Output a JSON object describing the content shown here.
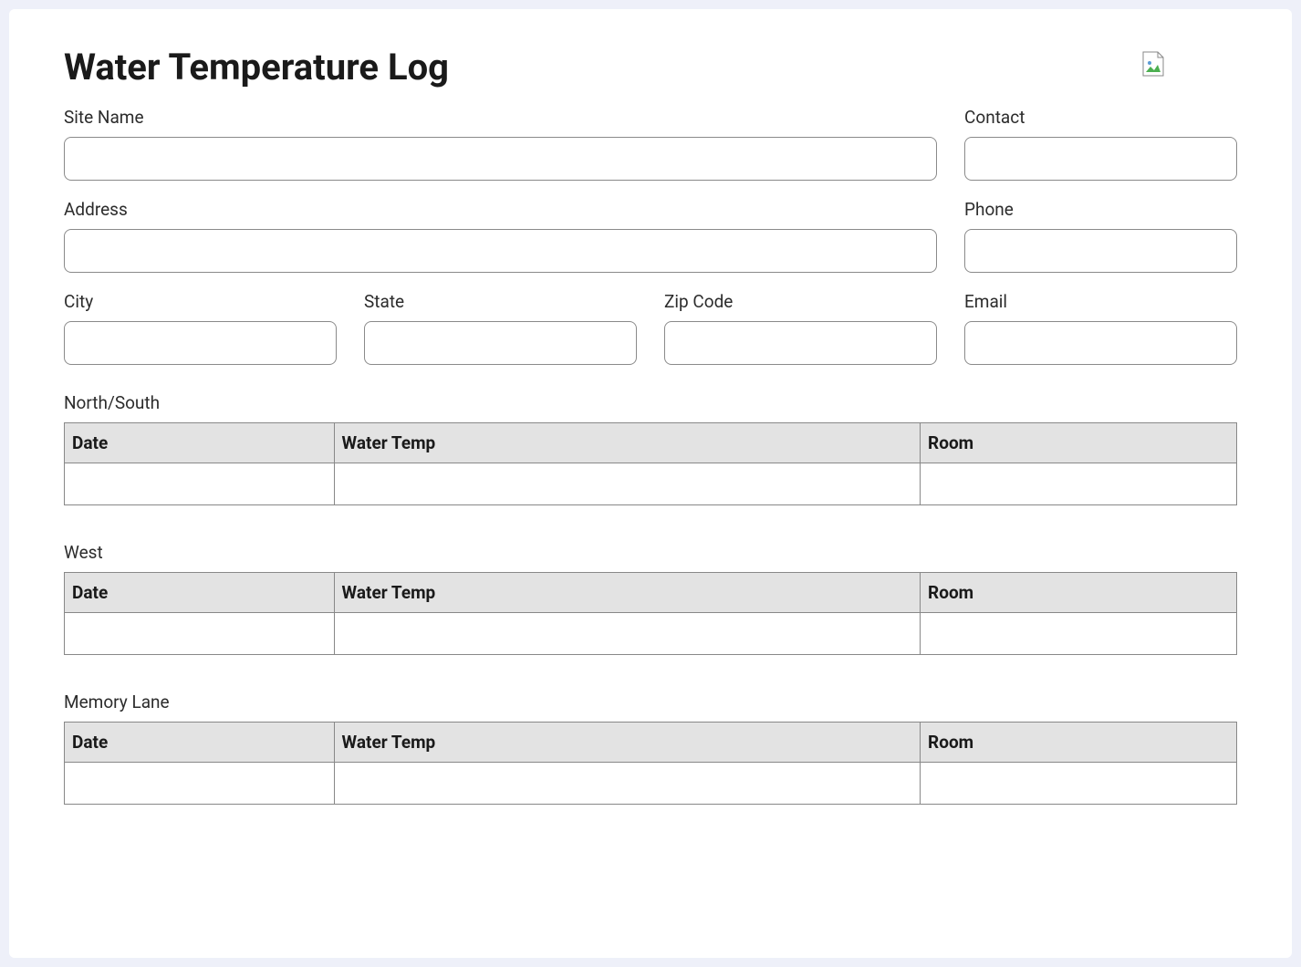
{
  "header": {
    "title": "Water Temperature Log"
  },
  "fields": {
    "site_name": {
      "label": "Site Name",
      "value": ""
    },
    "contact": {
      "label": "Contact",
      "value": ""
    },
    "address": {
      "label": "Address",
      "value": ""
    },
    "phone": {
      "label": "Phone",
      "value": ""
    },
    "city": {
      "label": "City",
      "value": ""
    },
    "state": {
      "label": "State",
      "value": ""
    },
    "zip": {
      "label": "Zip Code",
      "value": ""
    },
    "email": {
      "label": "Email",
      "value": ""
    }
  },
  "table_headers": {
    "date": "Date",
    "water_temp": "Water Temp",
    "room": "Room"
  },
  "sections": [
    {
      "title": "North/South",
      "rows": [
        {
          "date": "",
          "water_temp": "",
          "room": ""
        }
      ]
    },
    {
      "title": "West",
      "rows": [
        {
          "date": "",
          "water_temp": "",
          "room": ""
        }
      ]
    },
    {
      "title": "Memory Lane",
      "rows": [
        {
          "date": "",
          "water_temp": "",
          "room": ""
        }
      ]
    }
  ]
}
